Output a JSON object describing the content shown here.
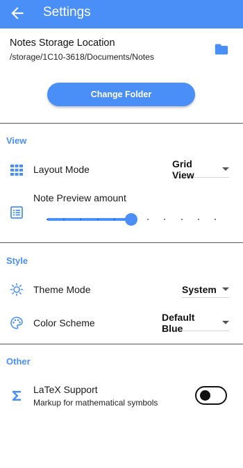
{
  "appbar": {
    "title": "Settings",
    "back_icon": "arrow-back-icon",
    "color": "#4a8ff7"
  },
  "storage": {
    "title": "Notes Storage Location",
    "path": "/storage/1C10-3618/Documents/Notes",
    "folder_icon": "folder-icon",
    "change_button": "Change Folder"
  },
  "view": {
    "header": "View",
    "layout_mode": {
      "label": "Layout Mode",
      "value": "Grid View",
      "icon": "grid-icon"
    },
    "preview": {
      "label": "Note Preview amount",
      "icon": "list-box-icon",
      "slider_level": 0.5,
      "steps": 10
    }
  },
  "style": {
    "header": "Style",
    "theme_mode": {
      "label": "Theme Mode",
      "value": "System",
      "icon": "brightness-icon"
    },
    "color_scheme": {
      "label": "Color Scheme",
      "value": "Default Blue",
      "icon": "palette-icon"
    }
  },
  "other": {
    "header": "Other",
    "latex": {
      "label": "LaTeX Support",
      "sublabel": "Markup for mathematical symbols",
      "icon": "sigma-icon",
      "enabled": false
    }
  }
}
